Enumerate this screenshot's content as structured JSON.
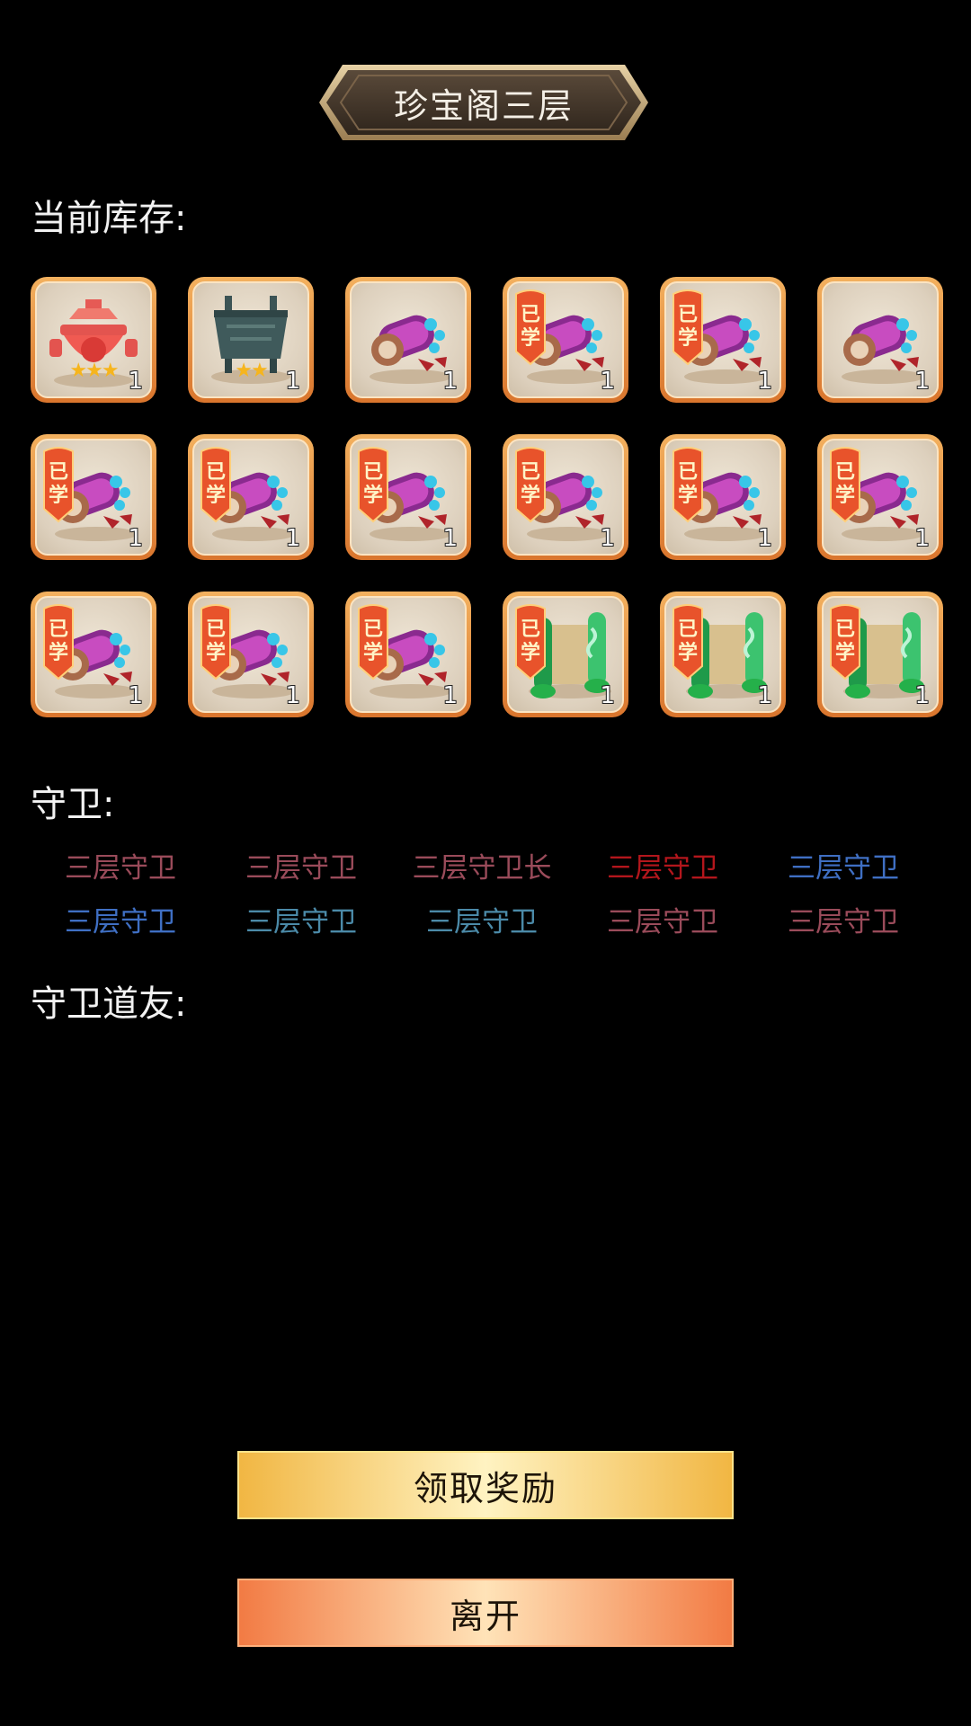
{
  "header": {
    "title": "珍宝阁三层"
  },
  "inventory": {
    "label": "当前库存:",
    "items": [
      {
        "name": "furnace-red",
        "learned": false,
        "stars": 3,
        "qty": "1"
      },
      {
        "name": "cauldron-bronze",
        "learned": false,
        "stars": 2,
        "qty": "1"
      },
      {
        "name": "scroll-purple",
        "learned": false,
        "stars": 0,
        "qty": "1"
      },
      {
        "name": "scroll-purple",
        "learned": true,
        "stars": 0,
        "qty": "1"
      },
      {
        "name": "scroll-purple",
        "learned": true,
        "stars": 0,
        "qty": "1"
      },
      {
        "name": "scroll-purple",
        "learned": false,
        "stars": 0,
        "qty": "1"
      },
      {
        "name": "scroll-purple",
        "learned": true,
        "stars": 0,
        "qty": "1"
      },
      {
        "name": "scroll-purple",
        "learned": true,
        "stars": 0,
        "qty": "1"
      },
      {
        "name": "scroll-purple",
        "learned": true,
        "stars": 0,
        "qty": "1"
      },
      {
        "name": "scroll-purple",
        "learned": true,
        "stars": 0,
        "qty": "1"
      },
      {
        "name": "scroll-purple",
        "learned": true,
        "stars": 0,
        "qty": "1"
      },
      {
        "name": "scroll-purple",
        "learned": true,
        "stars": 0,
        "qty": "1"
      },
      {
        "name": "scroll-purple",
        "learned": true,
        "stars": 0,
        "qty": "1"
      },
      {
        "name": "scroll-purple",
        "learned": true,
        "stars": 0,
        "qty": "1"
      },
      {
        "name": "scroll-purple",
        "learned": true,
        "stars": 0,
        "qty": "1"
      },
      {
        "name": "scroll-green",
        "learned": true,
        "stars": 0,
        "qty": "1"
      },
      {
        "name": "scroll-green",
        "learned": true,
        "stars": 0,
        "qty": "1"
      },
      {
        "name": "scroll-green",
        "learned": true,
        "stars": 0,
        "qty": "1"
      }
    ],
    "learned_text": [
      "已",
      "学"
    ]
  },
  "guards": {
    "label": "守卫:",
    "list": [
      {
        "name": "三层守卫",
        "color": "#9a4b5a"
      },
      {
        "name": "三层守卫",
        "color": "#9a4b5a"
      },
      {
        "name": "三层守卫长",
        "color": "#9a4b5a"
      },
      {
        "name": "三层守卫",
        "color": "#b3161c"
      },
      {
        "name": "三层守卫",
        "color": "#3f6fc3"
      },
      {
        "name": "三层守卫",
        "color": "#3f6fc3"
      },
      {
        "name": "三层守卫",
        "color": "#4b8aa8"
      },
      {
        "name": "三层守卫",
        "color": "#4b8aa8"
      },
      {
        "name": "三层守卫",
        "color": "#9a4b5a"
      },
      {
        "name": "三层守卫",
        "color": "#9a4b5a"
      }
    ]
  },
  "allies": {
    "label": "守卫道友:"
  },
  "buttons": {
    "claim": "领取奖励",
    "leave": "离开"
  }
}
